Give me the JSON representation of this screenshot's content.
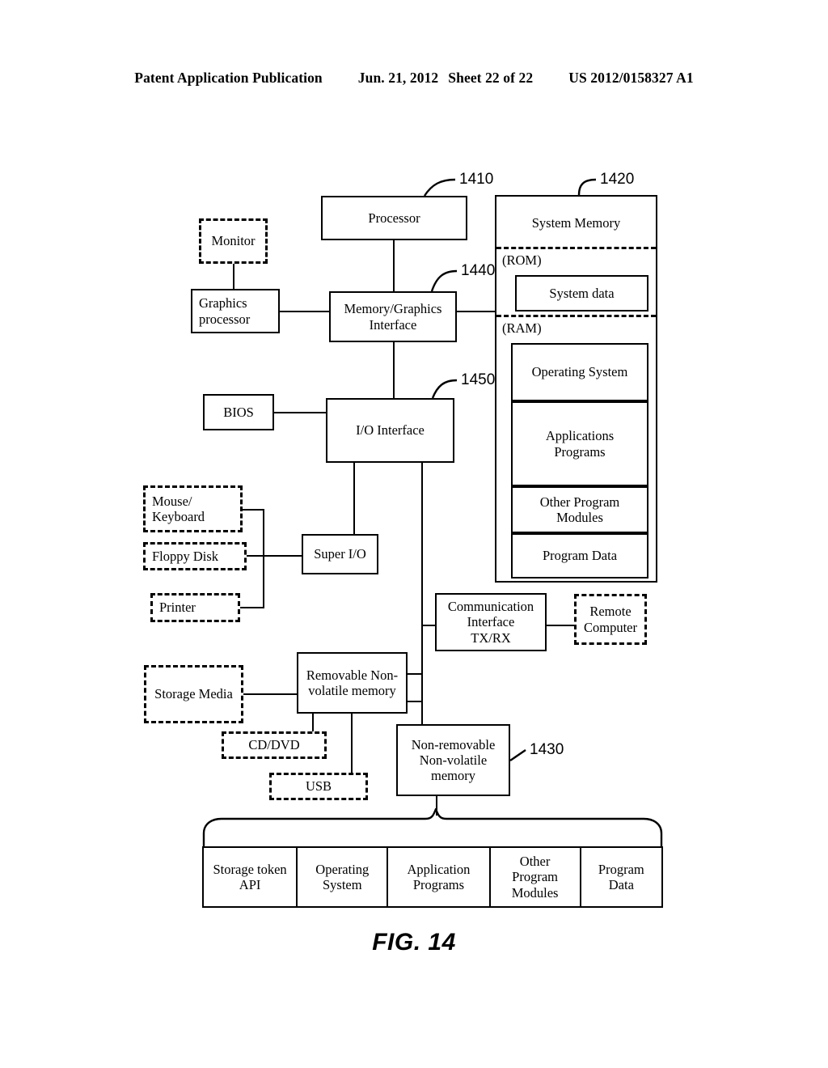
{
  "header": {
    "publication": "Patent Application Publication",
    "date": "Jun. 21, 2012",
    "sheet": "Sheet 22 of 22",
    "patent_number": "US 2012/0158327 A1"
  },
  "figure": {
    "caption": "FIG. 14"
  },
  "reference_numerals": {
    "processor": "1410",
    "system_memory": "1420",
    "non_removable_memory": "1430",
    "memory_graphics_interface": "1440",
    "io_interface": "1450"
  },
  "blocks": {
    "processor": "Processor",
    "monitor": "Monitor",
    "graphics_processor": "Graphics\nprocessor",
    "graphics_processor_line1": "Graphics",
    "graphics_processor_line2": "processor",
    "memory_graphics_interface_line1": "Memory/Graphics",
    "memory_graphics_interface_line2": "Interface",
    "io_interface": "I/O Interface",
    "bios": "BIOS",
    "mouse_keyboard_line1": "Mouse/",
    "mouse_keyboard_line2": "Keyboard",
    "floppy_disk": "Floppy Disk",
    "printer": "Printer",
    "super_io": "Super I/O",
    "communication_interface_line1": "Communication",
    "communication_interface_line2": "Interface",
    "communication_interface_line3": "TX/RX",
    "remote_computer_line1": "Remote",
    "remote_computer_line2": "Computer",
    "storage_media": "Storage Media",
    "removable_memory_line1": "Removable Non-",
    "removable_memory_line2": "volatile memory",
    "cd_dvd": "CD/DVD",
    "usb": "USB",
    "non_removable_memory_line1": "Non-removable",
    "non_removable_memory_line2": "Non-volatile",
    "non_removable_memory_line3": "memory"
  },
  "system_memory": {
    "title": "System Memory",
    "rom_label": "(ROM)",
    "ram_label": "(RAM)",
    "rom_contents": "System data",
    "ram_contents": {
      "operating_system": "Operating System",
      "applications_programs_line1": "Applications",
      "applications_programs_line2": "Programs",
      "other_program_modules_line1": "Other Program",
      "other_program_modules_line2": "Modules",
      "program_data": "Program Data"
    }
  },
  "storage_table": {
    "cells": [
      {
        "line1": "Storage token",
        "line2": "API",
        "line3": ""
      },
      {
        "line1": "Operating",
        "line2": "System",
        "line3": ""
      },
      {
        "line1": "Application",
        "line2": "Programs",
        "line3": ""
      },
      {
        "line1": "Other",
        "line2": "Program",
        "line3": "Modules"
      },
      {
        "line1": "Program",
        "line2": "Data",
        "line3": ""
      }
    ]
  }
}
